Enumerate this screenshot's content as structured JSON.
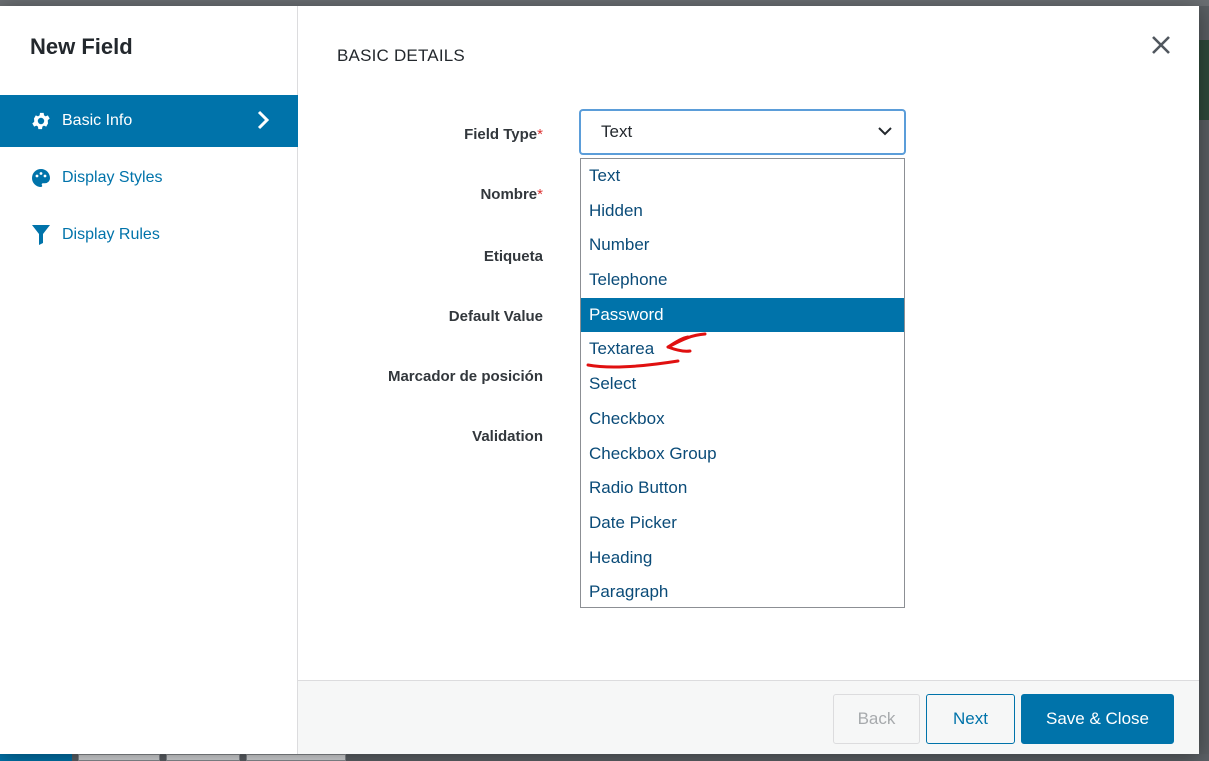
{
  "modal": {
    "title": "New Field",
    "section_title": "BASIC DETAILS"
  },
  "sidebar": {
    "items": [
      {
        "label": "Basic Info",
        "icon": "gear-icon",
        "active": true
      },
      {
        "label": "Display Styles",
        "icon": "palette-icon",
        "active": false
      },
      {
        "label": "Display Rules",
        "icon": "filter-icon",
        "active": false
      }
    ]
  },
  "form": {
    "labels": {
      "field_type": "Field Type",
      "nombre": "Nombre",
      "etiqueta": "Etiqueta",
      "default_value": "Default Value",
      "marcador": "Marcador de posición",
      "validation": "Validation"
    },
    "required_mark": "*",
    "field_type_value": "Text"
  },
  "dropdown": {
    "options": [
      "Text",
      "Hidden",
      "Number",
      "Telephone",
      "Password",
      "Textarea",
      "Select",
      "Checkbox",
      "Checkbox Group",
      "Radio Button",
      "Date Picker",
      "Heading",
      "Paragraph"
    ],
    "highlighted": "Password"
  },
  "footer": {
    "back_label": "Back",
    "next_label": "Next",
    "save_label": "Save & Close"
  },
  "colors": {
    "accent": "#0073aa",
    "annotation": "#e01010"
  }
}
